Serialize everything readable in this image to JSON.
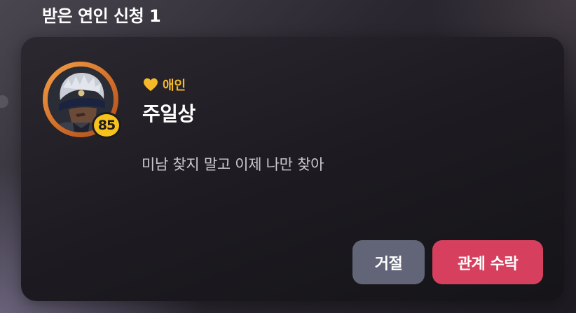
{
  "section": {
    "title": "받은 연인 신청 1"
  },
  "request": {
    "relation_label": "애인",
    "relation_icon": "heart-icon",
    "name": "주일상",
    "level": "85",
    "message": "미남 찾지 말고 이제 나만 찾아",
    "avatar_alt": "avatar"
  },
  "actions": {
    "reject_label": "거절",
    "accept_label": "관계 수락"
  },
  "colors": {
    "heart": "#f5b92a",
    "level_badge": "#f7c21a",
    "reject_button": "#616577",
    "accept_button": "#d6405e",
    "avatar_ring": "#e48a38"
  }
}
